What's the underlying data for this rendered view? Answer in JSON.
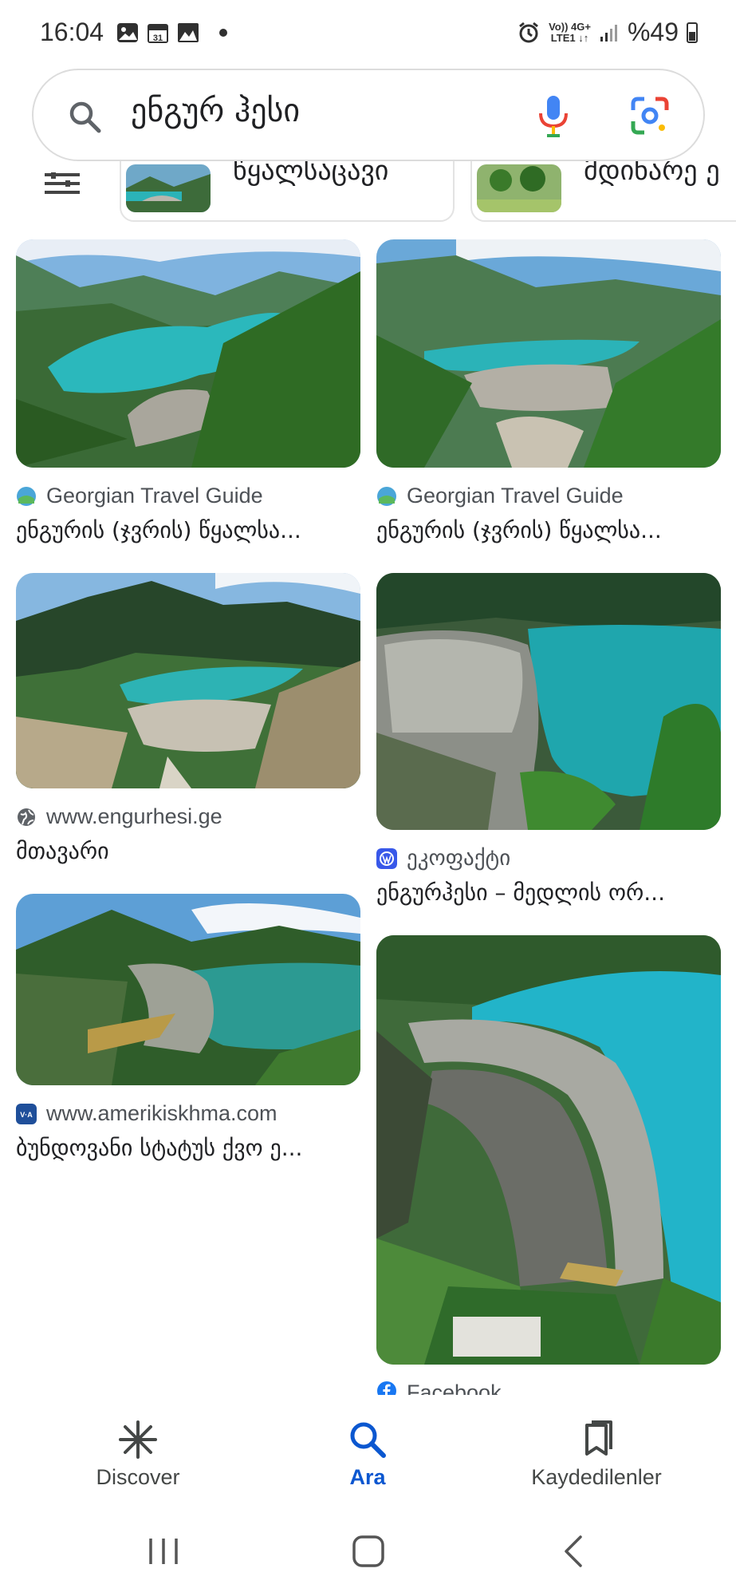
{
  "status_bar": {
    "time": "16:04",
    "network_top": "Vo)) 4G+",
    "network_bottom": "LTE1 ↓↑",
    "battery": "%49"
  },
  "search": {
    "query": "ენგურ ჰესი"
  },
  "chips": [
    {
      "label": "წყალსაცავი"
    },
    {
      "label": "მდინარე ე"
    }
  ],
  "results": [
    {
      "source": "Georgian Travel Guide",
      "title": "ენგურის (ჯვრის) წყალსა..."
    },
    {
      "source": "Georgian Travel Guide",
      "title": "ენგურის (ჯვრის) წყალსა..."
    },
    {
      "source": "www.engurhesi.ge",
      "title": "მთავარი"
    },
    {
      "source": "ეკოფაქტი",
      "title": "ენგურჰესი – მედლის ორ..."
    },
    {
      "source": "www.amerikiskhma.com",
      "title": "ბუნდოვანი სტატუს ქვო ე..."
    },
    {
      "source": "Facebook",
      "title": ""
    }
  ],
  "bottom_nav": {
    "discover": "Discover",
    "search": "Ara",
    "saved": "Kaydedilenler"
  },
  "colors": {
    "accent": "#0b57d0",
    "water": "#2bb3b8",
    "mountain": "#2f6b2a"
  }
}
